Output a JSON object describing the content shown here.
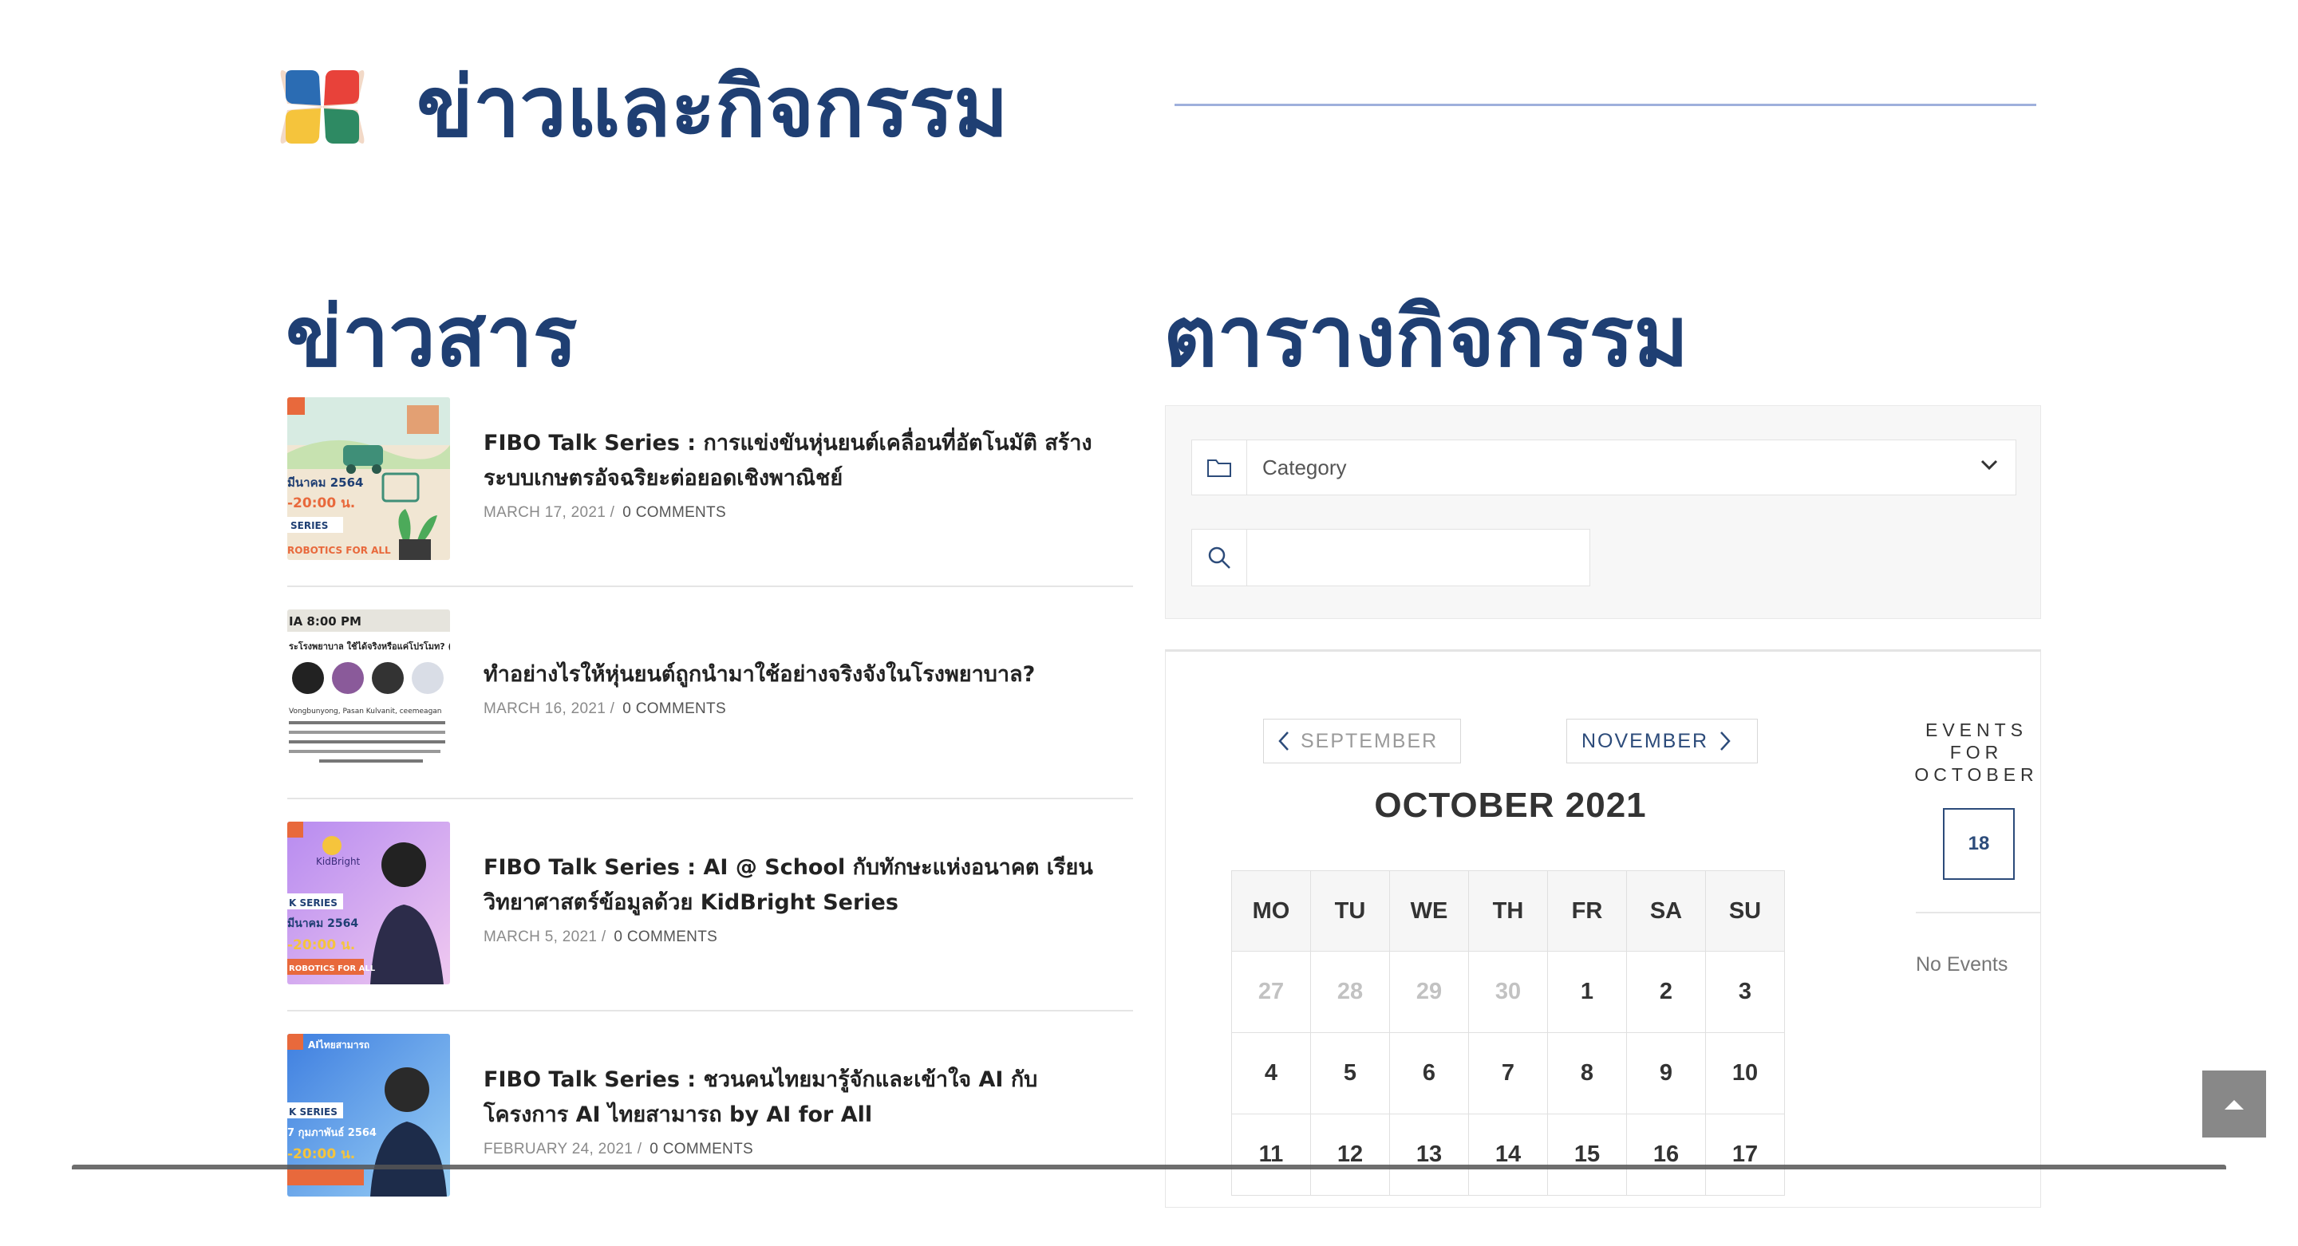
{
  "header": {
    "title": "ข่าวและกิจกรรม",
    "logo_colors": [
      "#2b6cb3",
      "#e8423a",
      "#f5c43c",
      "#2e8a63",
      "#f2d9c7"
    ]
  },
  "news": {
    "heading": "ข่าวสาร",
    "items": [
      {
        "title": "FIBO Talk Series : การแข่งขันหุ่นยนต์เคลื่อนที่อัตโนมัติ สร้างระบบเกษตรอัจฉริยะต่อยอดเชิงพาณิชย์",
        "date": "MARCH 17, 2021 /",
        "comments": "0 COMMENTS",
        "thumb_lines": [
          "มีนาคม 2564",
          "-20:00 น.",
          "SERIES",
          "ROBOTICS FOR ALL"
        ]
      },
      {
        "title": "ทำอย่างไรให้หุ่นยนต์ถูกนำมาใช้อย่างจริงจังในโรงพยาบาล?",
        "date": "MARCH 16, 2021 /",
        "comments": "0 COMMENTS",
        "thumb_lines": [
          "IA 8:00 PM",
          "ระโรงพยาบาล ใช้ได้จริงหรือแค่โปรโมท? (",
          "Vongbunyong, Pasan Kulvanit, ceemeagan"
        ]
      },
      {
        "title": "FIBO Talk Series : AI @ School กับทักษะแห่งอนาคต เรียนวิทยาศาสตร์ข้อมูลด้วย KidBright Series",
        "date": "MARCH 5, 2021 /",
        "comments": "0 COMMENTS",
        "thumb_lines": [
          "KidBright",
          "K SERIES",
          "มีนาคม 2564",
          "-20:00 น.",
          "ROBOTICS FOR ALL"
        ]
      },
      {
        "title": "FIBO Talk Series : ชวนคนไทยมารู้จักและเข้าใจ AI กับ โครงการ AI ไทยสามารถ by AI for All",
        "date": "FEBRUARY 24, 2021 /",
        "comments": "0 COMMENTS",
        "thumb_lines": [
          "AIไทยสามารถ",
          "K SERIES",
          "7 กุมภาพันธ์ 2564",
          "-20:00 น."
        ]
      }
    ]
  },
  "events": {
    "heading": "ตารางกิจกรรม",
    "category_placeholder": "Category",
    "search_value": "",
    "prev_label": "SEPTEMBER",
    "next_label": "NOVEMBER",
    "month_title": "OCTOBER 2021",
    "weekdays": [
      "MO",
      "TU",
      "WE",
      "TH",
      "FR",
      "SA",
      "SU"
    ],
    "weeks": [
      [
        {
          "d": "27",
          "m": true
        },
        {
          "d": "28",
          "m": true
        },
        {
          "d": "29",
          "m": true
        },
        {
          "d": "30",
          "m": true
        },
        {
          "d": "1"
        },
        {
          "d": "2"
        },
        {
          "d": "3"
        }
      ],
      [
        {
          "d": "4"
        },
        {
          "d": "5"
        },
        {
          "d": "6"
        },
        {
          "d": "7"
        },
        {
          "d": "8"
        },
        {
          "d": "9"
        },
        {
          "d": "10"
        }
      ],
      [
        {
          "d": "11"
        },
        {
          "d": "12"
        },
        {
          "d": "13"
        },
        {
          "d": "14"
        },
        {
          "d": "15"
        },
        {
          "d": "16"
        },
        {
          "d": "17"
        }
      ]
    ],
    "events_for_lines": [
      "EVENTS",
      "FOR",
      "OCTOBER"
    ],
    "selected_day": "18",
    "no_events": "No Events"
  },
  "colors": {
    "brand": "#1f3f73",
    "accent": "#2c4b7a",
    "header_line": "#9fb0dc"
  },
  "icons": {
    "category": "folder-icon",
    "search": "search-icon",
    "back_to_top": "chevron-up-icon"
  }
}
